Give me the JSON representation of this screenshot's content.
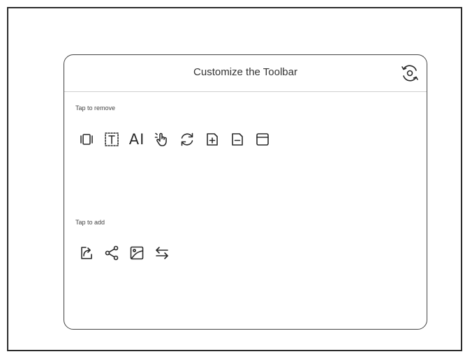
{
  "dialog": {
    "title": "Customize the Toolbar",
    "reset_icon": "reset-icon"
  },
  "remove_section": {
    "label": "Tap to remove",
    "items": [
      {
        "icon": "page-view-icon"
      },
      {
        "icon": "text-box-icon"
      },
      {
        "icon": "ai-icon",
        "text": "AI"
      },
      {
        "icon": "hand-touch-icon"
      },
      {
        "icon": "refresh-icon"
      },
      {
        "icon": "add-page-icon"
      },
      {
        "icon": "remove-page-icon"
      },
      {
        "icon": "save-icon"
      }
    ]
  },
  "add_section": {
    "label": "Tap to add",
    "items": [
      {
        "icon": "export-icon"
      },
      {
        "icon": "share-icon"
      },
      {
        "icon": "image-icon"
      },
      {
        "icon": "swap-icon"
      }
    ]
  }
}
